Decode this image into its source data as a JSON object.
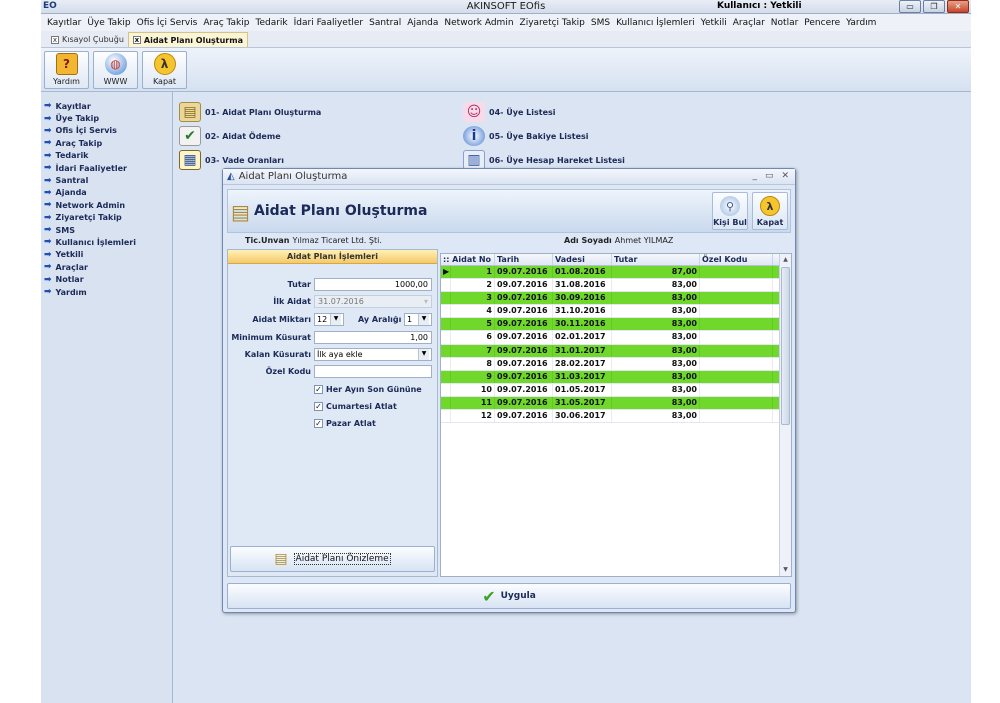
{
  "app": {
    "icon_text": "EO",
    "title": "AKINSOFT EOfis",
    "user_label": "Kullanıcı : Yetkili"
  },
  "window_controls": {
    "minimize": "▭",
    "restore": "❐",
    "close": "✕"
  },
  "menu": [
    "Kayıtlar",
    "Üye Takip",
    "Ofis İçi Servis",
    "Araç Takip",
    "Tedarik",
    "İdari Faaliyetler",
    "Santral",
    "Ajanda",
    "Network Admin",
    "Ziyaretçi Takip",
    "SMS",
    "Kullanıcı İşlemleri",
    "Yetkili",
    "Araçlar",
    "Notlar",
    "Pencere",
    "Yardım"
  ],
  "tabs": [
    {
      "label": "Kısayol Çubuğu",
      "active": false
    },
    {
      "label": "Aidat Planı Oluşturma",
      "active": true
    }
  ],
  "toolbar": [
    {
      "label": "Yardım",
      "icon": "help-icon",
      "glyph": "?"
    },
    {
      "label": "WWW",
      "icon": "globe-icon",
      "glyph": "◍"
    },
    {
      "label": "Kapat",
      "icon": "exit-icon",
      "glyph": "λ"
    }
  ],
  "sidebar": [
    "Kayıtlar",
    "Üye Takip",
    "Ofis İçi Servis",
    "Araç Takip",
    "Tedarik",
    "İdari Faaliyetler",
    "Santral",
    "Ajanda",
    "Network Admin",
    "Ziyaretçi Takip",
    "SMS",
    "Kullanıcı İşlemleri",
    "Yetkili",
    "Araçlar",
    "Notlar",
    "Yardım"
  ],
  "shortcuts": [
    {
      "label": "01- Aidat Planı Oluşturma",
      "icon": "document-stack-icon"
    },
    {
      "label": "02- Aidat Ödeme",
      "icon": "document-check-icon"
    },
    {
      "label": "03- Vade Oranları",
      "icon": "calendar-icon"
    },
    {
      "label": "04- Üye Listesi",
      "icon": "users-icon"
    },
    {
      "label": "05- Üye Bakiye Listesi",
      "icon": "info-icon"
    },
    {
      "label": "06- Üye Hesap Hareket Listesi",
      "icon": "report-icon"
    }
  ],
  "dialog": {
    "title": "Aidat Planı Oluşturma",
    "controls": {
      "minimize": "_",
      "maximize": "▭",
      "close": "✕"
    },
    "header_title": "Aidat Planı Oluşturma",
    "buttons": {
      "find_person": "Kişi Bul",
      "close": "Kapat"
    },
    "company_label": "Tic.Unvan",
    "company_value": "Yılmaz Ticaret Ltd. Şti.",
    "name_label": "Adı Soyadı",
    "name_value": "Ahmet YILMAZ",
    "form": {
      "heading": "Aidat Planı İşlemleri",
      "tutar_label": "Tutar",
      "tutar_value": "1000,00",
      "ilk_aidat_label": "İlk Aidat",
      "ilk_aidat_value": "31.07.2016",
      "aidat_miktari_label": "Aidat Miktarı",
      "aidat_miktari_value": "12",
      "ay_araligi_label": "Ay Aralığı",
      "ay_araligi_value": "1",
      "min_kusurat_label": "Minimum Küsurat",
      "min_kusurat_value": "1,00",
      "kalan_kusurat_label": "Kalan Küsuratı",
      "kalan_kusurat_value": "İlk aya ekle",
      "ozel_kodu_label": "Özel Kodu",
      "ozel_kodu_value": "",
      "checks": [
        {
          "label": "Her Ayın Son Gününe",
          "checked": true
        },
        {
          "label": "Cumartesi Atlat",
          "checked": true
        },
        {
          "label": "Pazar Atlat",
          "checked": true
        }
      ],
      "preview_button": "Aidat Planı Önizleme"
    },
    "grid": {
      "columns": [
        ":: Aidat No",
        "Tarih",
        "Vadesi",
        "Tutar",
        "Özel Kodu"
      ],
      "rows": [
        {
          "no": "1",
          "tarih": "09.07.2016",
          "vade": "01.08.2016",
          "tutar": "87,00",
          "ozel": "",
          "highlight": true,
          "current": true
        },
        {
          "no": "2",
          "tarih": "09.07.2016",
          "vade": "31.08.2016",
          "tutar": "83,00",
          "ozel": "",
          "highlight": false
        },
        {
          "no": "3",
          "tarih": "09.07.2016",
          "vade": "30.09.2016",
          "tutar": "83,00",
          "ozel": "",
          "highlight": true
        },
        {
          "no": "4",
          "tarih": "09.07.2016",
          "vade": "31.10.2016",
          "tutar": "83,00",
          "ozel": "",
          "highlight": false
        },
        {
          "no": "5",
          "tarih": "09.07.2016",
          "vade": "30.11.2016",
          "tutar": "83,00",
          "ozel": "",
          "highlight": true
        },
        {
          "no": "6",
          "tarih": "09.07.2016",
          "vade": "02.01.2017",
          "tutar": "83,00",
          "ozel": "",
          "highlight": false
        },
        {
          "no": "7",
          "tarih": "09.07.2016",
          "vade": "31.01.2017",
          "tutar": "83,00",
          "ozel": "",
          "highlight": true
        },
        {
          "no": "8",
          "tarih": "09.07.2016",
          "vade": "28.02.2017",
          "tutar": "83,00",
          "ozel": "",
          "highlight": false
        },
        {
          "no": "9",
          "tarih": "09.07.2016",
          "vade": "31.03.2017",
          "tutar": "83,00",
          "ozel": "",
          "highlight": true
        },
        {
          "no": "10",
          "tarih": "09.07.2016",
          "vade": "01.05.2017",
          "tutar": "83,00",
          "ozel": "",
          "highlight": false
        },
        {
          "no": "11",
          "tarih": "09.07.2016",
          "vade": "31.05.2017",
          "tutar": "83,00",
          "ozel": "",
          "highlight": true
        },
        {
          "no": "12",
          "tarih": "09.07.2016",
          "vade": "30.06.2017",
          "tutar": "83,00",
          "ozel": "",
          "highlight": false
        }
      ]
    },
    "apply_button": "Uygula"
  },
  "colors": {
    "highlight_row": "#6fd82a",
    "form_header": "#f5c968",
    "nav_text": "#1b2a57"
  }
}
